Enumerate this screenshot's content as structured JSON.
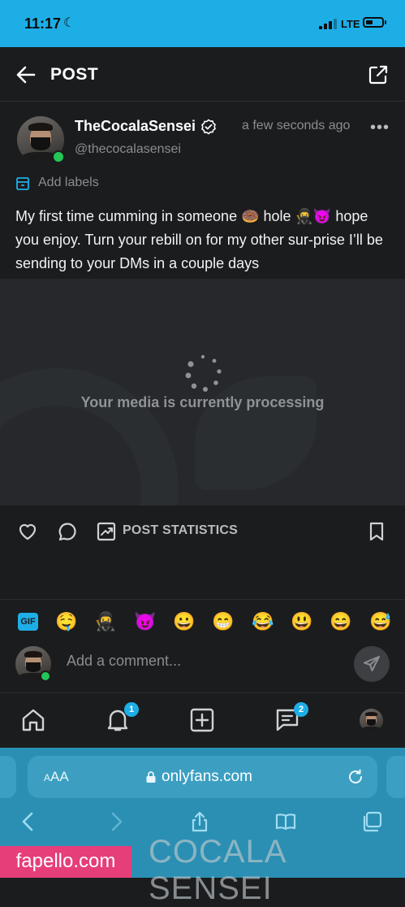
{
  "status_bar": {
    "time": "11:17",
    "moon_icon": "moon-icon",
    "network": "LTE",
    "battery_level_percent": 40
  },
  "header": {
    "title": "POST",
    "back_icon": "arrow-left-icon",
    "share_icon": "share-icon"
  },
  "post": {
    "author": {
      "name": "TheCocalaSensei",
      "handle": "@thecocalasensei",
      "verified": true,
      "online": true
    },
    "time_ago": "a few seconds ago",
    "more_label": "•••",
    "add_labels": "Add labels",
    "caption": "My first time cumming in someone 🍩 hole 🥷😈 hope you enjoy. Turn your rebill on for my other sur-prise I’ll be sending to your DMs in a couple days",
    "media_status": "Your media is currently processing"
  },
  "actions": {
    "like_icon": "heart-icon",
    "comment_icon": "comment-icon",
    "stats_icon": "chart-icon",
    "stats_label": "POST STATISTICS",
    "bookmark_icon": "bookmark-icon"
  },
  "emoji_bar": {
    "gif_label": "GIF",
    "emojis": [
      "🤤",
      "🥷",
      "😈",
      "😀",
      "😁",
      "😂",
      "😃",
      "😄",
      "😅"
    ]
  },
  "comment": {
    "placeholder": "Add a comment..."
  },
  "bottom_nav": {
    "items": [
      {
        "name": "home",
        "icon": "home-icon"
      },
      {
        "name": "notifications",
        "icon": "bell-icon",
        "badge": "1"
      },
      {
        "name": "add-post",
        "icon": "plus-square-icon"
      },
      {
        "name": "messages",
        "icon": "message-icon",
        "badge": "2"
      },
      {
        "name": "profile",
        "icon": "avatar-icon"
      }
    ]
  },
  "browser": {
    "aa_label": "AA",
    "url": "onlyfans.com",
    "toolbar_icons": [
      "back-icon",
      "forward-icon",
      "share-icon",
      "bookmarks-icon",
      "tabs-icon"
    ]
  },
  "watermarks": {
    "site": "fapello.com",
    "overlay": "COCALA SENSEI"
  },
  "colors": {
    "accent": "#1eaee6",
    "background": "#1b1c1e",
    "online": "#24c656",
    "browser_bar": "#2b8fb3",
    "watermark_pink": "#e63e79"
  }
}
